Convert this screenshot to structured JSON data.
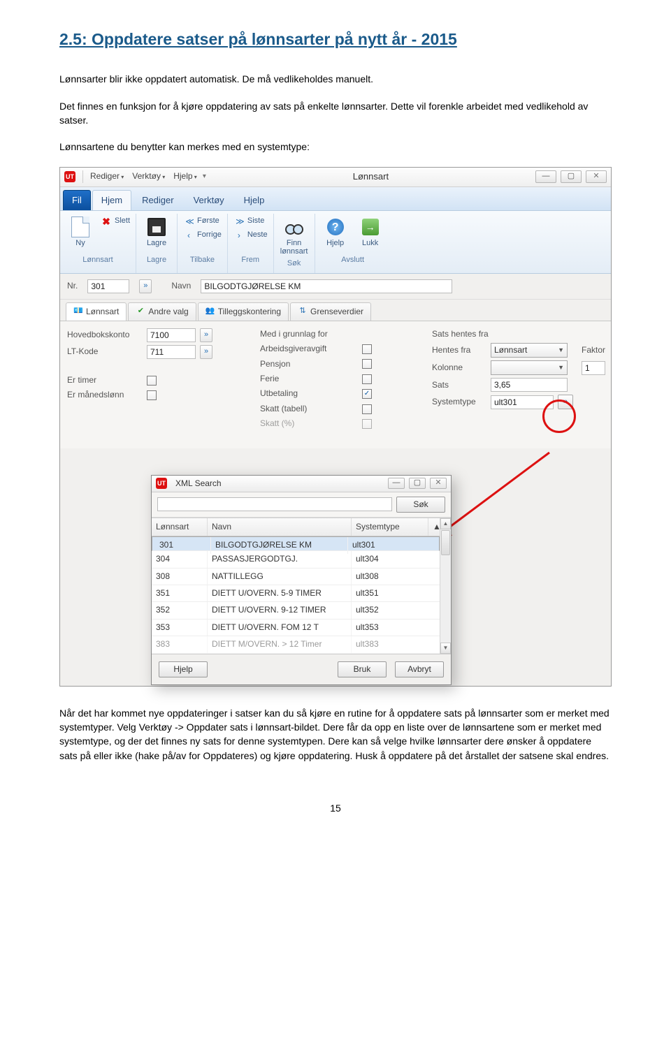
{
  "section_title": "2.5: Oppdatere satser på lønnsarter på nytt år - 2015",
  "intro_p1": "Lønnsarter blir ikke oppdatert automatisk. De må vedlikeholdes manuelt.",
  "intro_p2": "Det finnes en funksjon for å kjøre oppdatering av sats på enkelte lønnsarter. Dette vil forenkle arbeidet med vedlikehold av satser.",
  "intro_p3": "Lønnsartene du benytter kan merkes med en systemtype:",
  "window": {
    "menu": {
      "rediger": "Rediger",
      "verktoy": "Verktøy",
      "hjelp": "Hjelp"
    },
    "title": "Lønnsart"
  },
  "ribbon": {
    "tabs": {
      "fil": "Fil",
      "hjem": "Hjem",
      "rediger": "Rediger",
      "verktoy": "Verktøy",
      "hjelp": "Hjelp"
    },
    "groups": {
      "lonnsart": "Lønnsart",
      "lagre": "Lagre",
      "tilbake": "Tilbake",
      "frem": "Frem",
      "sok": "Søk",
      "avslutt": "Avslutt"
    },
    "items": {
      "ny": "Ny",
      "lagre": "Lagre",
      "slett": "Slett",
      "forste": "Første",
      "siste": "Siste",
      "forrige": "Forrige",
      "neste": "Neste",
      "finn": "Finn lønnsart",
      "hjelp": "Hjelp",
      "lukk": "Lukk"
    }
  },
  "head_fields": {
    "nr_label": "Nr.",
    "nr": "301",
    "navn_label": "Navn",
    "navn": "BILGODTGJØRELSE KM"
  },
  "innertabs": {
    "lonnsart": "Lønnsart",
    "andre": "Andre valg",
    "tillegg": "Tilleggskontering",
    "grense": "Grenseverdier"
  },
  "form": {
    "hovedbok_label": "Hovedbokskonto",
    "hovedbok": "7100",
    "ltkode_label": "LT-Kode",
    "ltkode": "711",
    "ertimer": "Er timer",
    "ermnd": "Er månedslønn",
    "medigr": "Med i grunnlag for",
    "arb": "Arbeidsgiveravgift",
    "pensjon": "Pensjon",
    "ferie": "Ferie",
    "utbet": "Utbetaling",
    "skatt_t": "Skatt (tabell)",
    "skatt_p": "Skatt (%)",
    "satshentes": "Sats hentes fra",
    "hentesfra_lbl": "Hentes fra",
    "hentesfra_val": "Lønnsart",
    "kolonne": "Kolonne",
    "faktor_lbl": "Faktor",
    "faktor": "1",
    "sats_lbl": "Sats",
    "sats": "3,65",
    "systemtype_lbl": "Systemtype",
    "systemtype": "ult301"
  },
  "dialog": {
    "title": "XML Search",
    "sok": "Søk",
    "cols": {
      "lonnsart": "Lønnsart",
      "navn": "Navn",
      "systemtype": "Systemtype"
    },
    "rows": [
      {
        "l": "301",
        "n": "BILGODTGJØRELSE KM",
        "s": "ult301"
      },
      {
        "l": "304",
        "n": "PASSASJERGODTGJ.",
        "s": "ult304"
      },
      {
        "l": "308",
        "n": "NATTILLEGG",
        "s": "ult308"
      },
      {
        "l": "351",
        "n": "DIETT U/OVERN. 5-9 TIMER",
        "s": "ult351"
      },
      {
        "l": "352",
        "n": "DIETT U/OVERN. 9-12 TIMER",
        "s": "ult352"
      },
      {
        "l": "353",
        "n": "DIETT U/OVERN. FOM 12 T",
        "s": "ult353"
      },
      {
        "l": "383",
        "n": "DIETT M/OVERN. > 12 Timer",
        "s": "ult383"
      }
    ],
    "btns": {
      "hjelp": "Hjelp",
      "bruk": "Bruk",
      "avbryt": "Avbryt"
    }
  },
  "outro": "Når det har kommet nye oppdateringer i satser kan du så kjøre en rutine for å oppdatere sats på lønnsarter som er merket med systemtyper. Velg Verktøy -> Oppdater sats i lønnsart-bildet. Dere får da opp en liste over de lønnsartene som er merket med systemtype, og der det finnes ny sats for denne systemtypen. Dere kan så velge hvilke lønnsarter dere ønsker å oppdatere sats på eller ikke (hake på/av for Oppdateres) og kjøre oppdatering. Husk å oppdatere på det årstallet der satsene skal endres.",
  "page_number": "15"
}
